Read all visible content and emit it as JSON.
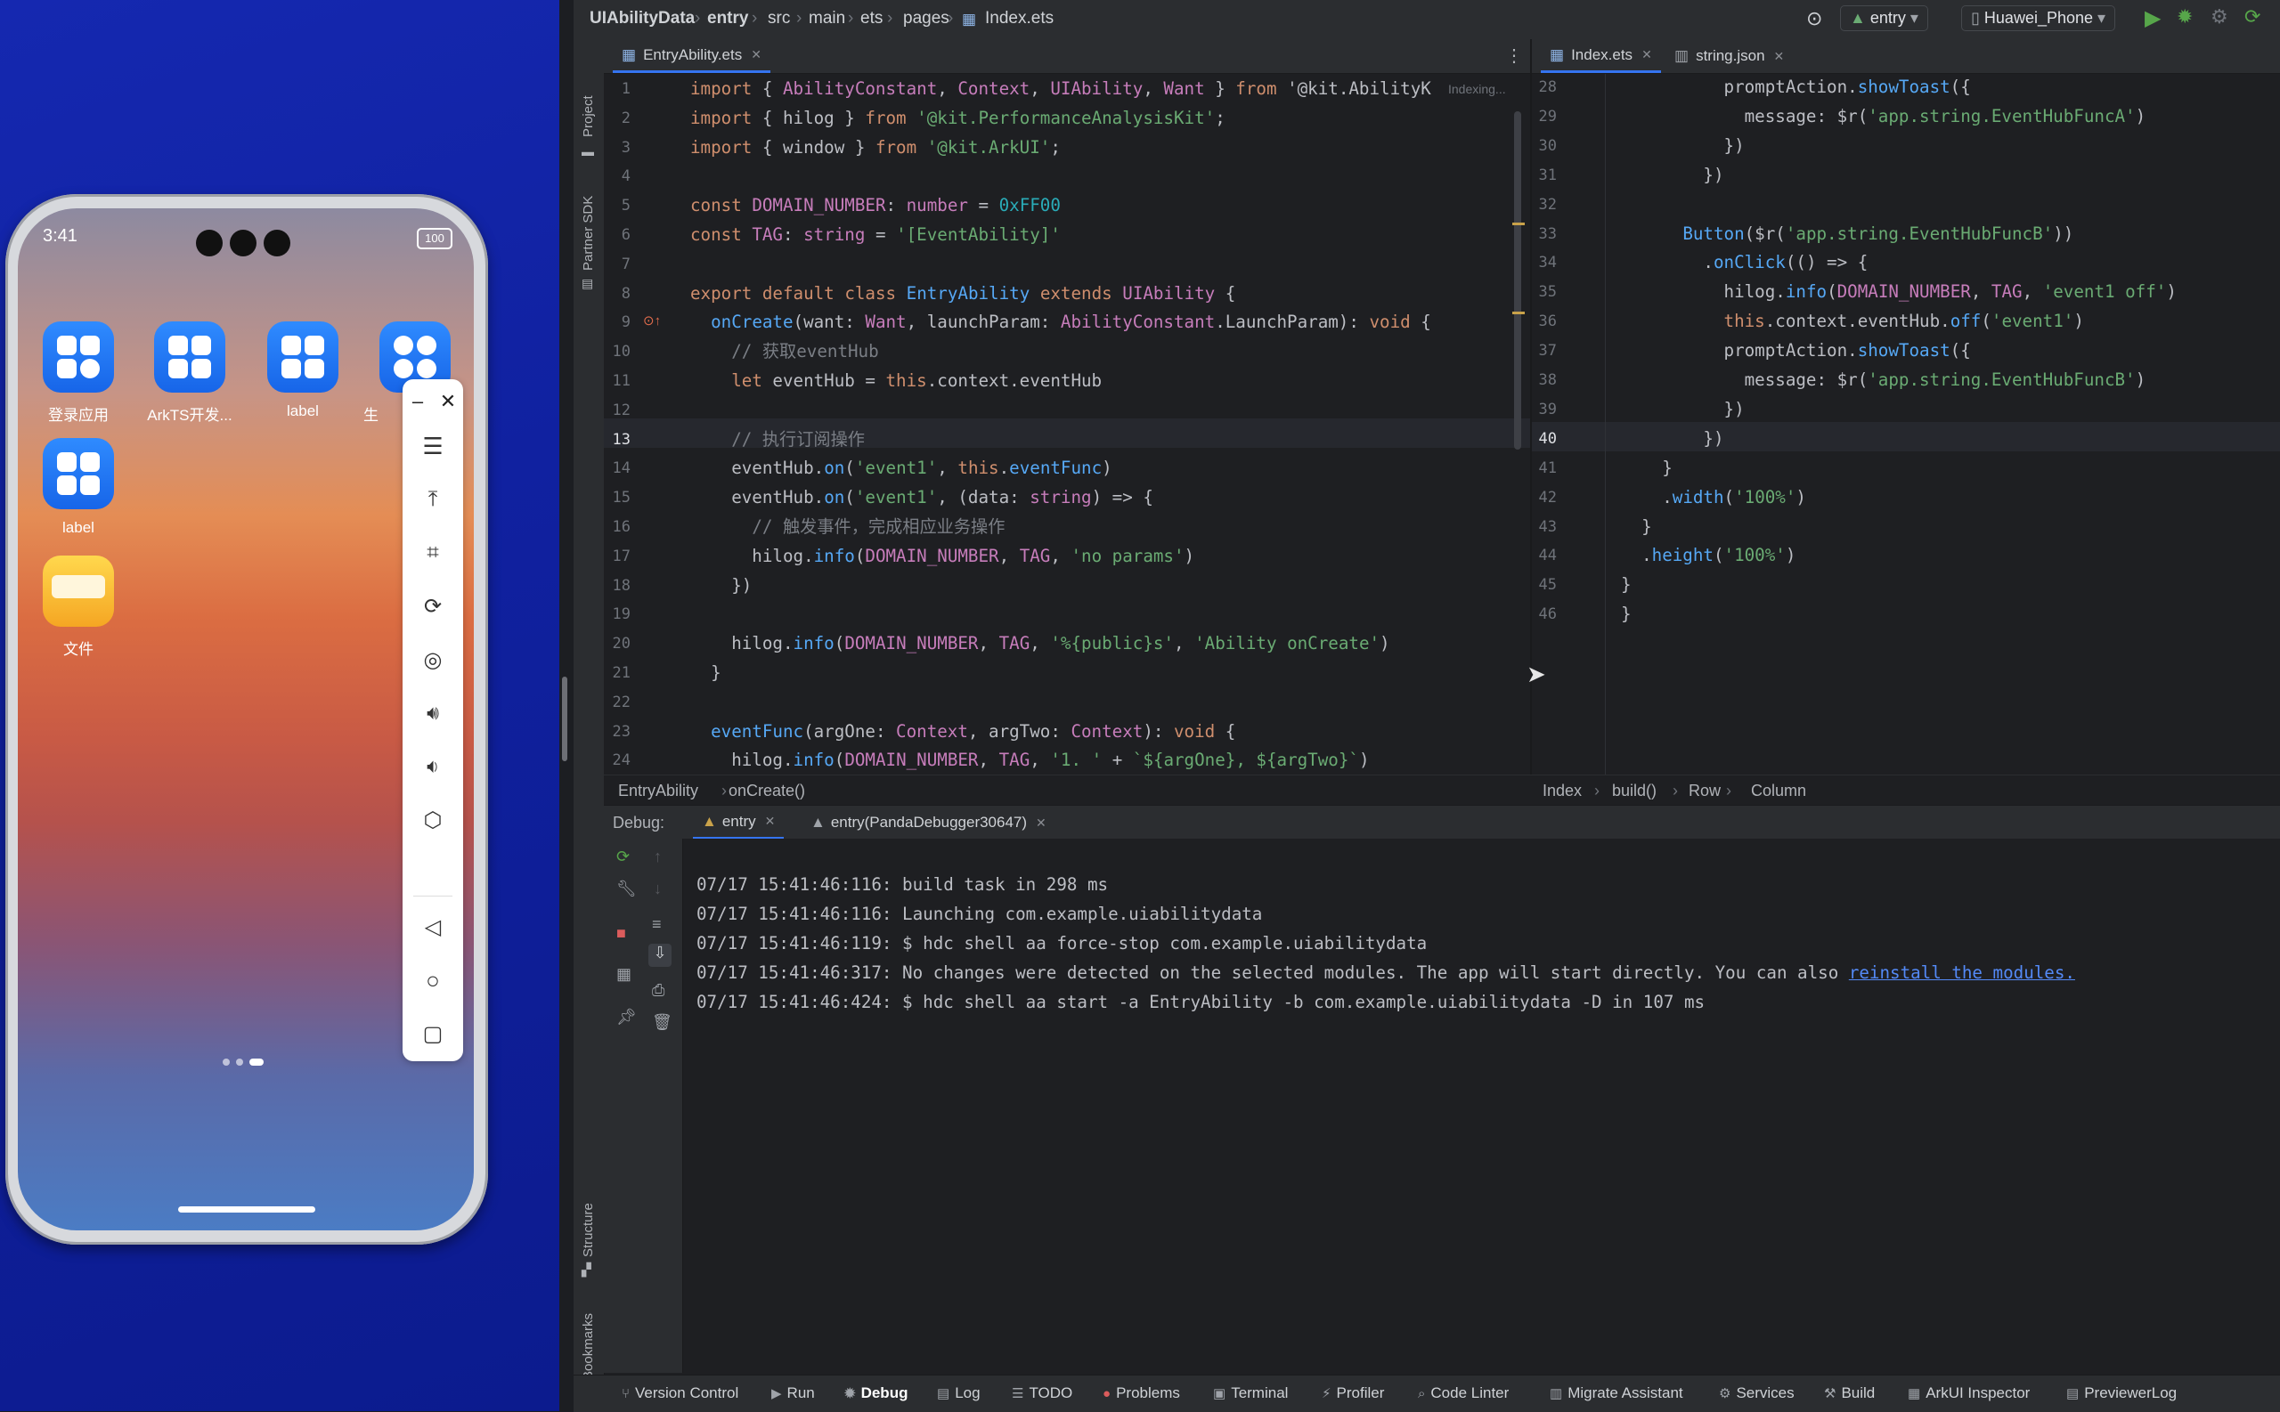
{
  "phone": {
    "status_time": "3:41",
    "battery": "100",
    "apps": [
      {
        "label": "登录应用"
      },
      {
        "label": "ArkTS开发..."
      },
      {
        "label": "label"
      },
      {
        "label": "生"
      },
      {
        "label": "label"
      },
      {
        "label": "文件"
      }
    ],
    "float_bar_icons": [
      "minimize-icon",
      "close-icon",
      "menu-icon",
      "pin-top-icon",
      "crop-icon",
      "rotate-icon",
      "screenshot-icon",
      "volume-up-icon",
      "volume-down-icon",
      "fold-icon",
      "back-icon",
      "home-icon",
      "recents-icon"
    ]
  },
  "ide": {
    "breadcrumb": [
      "UIAbilityData",
      "entry",
      "src",
      "main",
      "ets",
      "pages",
      "Index.ets"
    ],
    "run_config": "entry",
    "device": "Huawei_Phone",
    "left_tools": [
      "Project",
      "Partner SDK",
      "Structure",
      "Bookmarks"
    ],
    "left_editor": {
      "tab": "EntryAbility.ets",
      "indexing": "Indexing...",
      "line_numbers": [
        "1",
        "2",
        "3",
        "4",
        "5",
        "6",
        "7",
        "8",
        "9",
        "10",
        "11",
        "12",
        "13",
        "14",
        "15",
        "16",
        "17",
        "18",
        "19",
        "20",
        "21",
        "22",
        "23",
        "24"
      ],
      "lines": [
        "import { AbilityConstant, Context, UIAbility, Want } from '@kit.AbilityK",
        "import { hilog } from '@kit.PerformanceAnalysisKit';",
        "import { window } from '@kit.ArkUI';",
        "",
        "const DOMAIN_NUMBER: number = 0xFF00",
        "const TAG: string = '[EventAbility]'",
        "",
        "export default class EntryAbility extends UIAbility {",
        "  onCreate(want: Want, launchParam: AbilityConstant.LaunchParam): void {",
        "    // 获取eventHub",
        "    let eventHub = this.context.eventHub",
        "",
        "    // 执行订阅操作",
        "    eventHub.on('event1', this.eventFunc)",
        "    eventHub.on('event1', (data: string) => {",
        "      // 触发事件，完成相应业务操作",
        "      hilog.info(DOMAIN_NUMBER, TAG, 'no params')",
        "    })",
        "",
        "    hilog.info(DOMAIN_NUMBER, TAG, '%{public}s', 'Ability onCreate')",
        "  }",
        "",
        "  eventFunc(argOne: Context, argTwo: Context): void {",
        "    hilog.info(DOMAIN_NUMBER, TAG, '1. ' + `${argOne}, ${argTwo}`)"
      ]
    },
    "right_editor": {
      "tabs": [
        "Index.ets",
        "string.json"
      ],
      "line_numbers": [
        "28",
        "29",
        "30",
        "31",
        "32",
        "33",
        "34",
        "35",
        "36",
        "37",
        "38",
        "39",
        "40",
        "41",
        "42",
        "43",
        "44",
        "45",
        "46"
      ],
      "lines": [
        "          promptAction.showToast({",
        "            message: $r('app.string.EventHubFuncA')",
        "          })",
        "        })",
        "",
        "      Button($r('app.string.EventHubFuncB'))",
        "        .onClick(() => {",
        "          hilog.info(DOMAIN_NUMBER, TAG, 'event1 off')",
        "          this.context.eventHub.off('event1')",
        "          promptAction.showToast({",
        "            message: $r('app.string.EventHubFuncB')",
        "          })",
        "        })",
        "    }",
        "    .width('100%')",
        "  }",
        "  .height('100%')",
        "}",
        "}"
      ]
    },
    "code_crumbs_left": [
      "EntryAbility",
      "onCreate()"
    ],
    "code_crumbs_right": [
      "Index",
      "build()",
      "Row",
      "Column"
    ],
    "debug": {
      "label": "Debug:",
      "tabs": [
        "entry",
        "entry(PandaDebugger30647)"
      ],
      "log": [
        "07/17 15:41:46:116: build task in 298 ms",
        "07/17 15:41:46:116: Launching com.example.uiabilitydata",
        "07/17 15:41:46:119: $ hdc shell aa force-stop com.example.uiabilitydata",
        "07/17 15:41:46:317: No changes were detected on the selected modules. The app will start directly. You can also ",
        "07/17 15:41:46:424: $ hdc shell aa start -a EntryAbility -b com.example.uiabilitydata -D in 107 ms"
      ],
      "log_link": "reinstall the modules."
    },
    "bottom_tools": [
      "Version Control",
      "Run",
      "Debug",
      "Log",
      "TODO",
      "Problems",
      "Terminal",
      "Profiler",
      "Code Linter",
      "Migrate Assistant",
      "Services",
      "Build",
      "ArkUI Inspector",
      "PreviewerLog"
    ]
  }
}
